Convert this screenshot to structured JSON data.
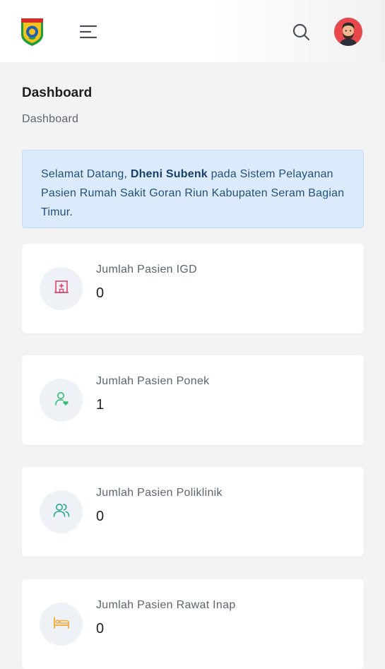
{
  "header": {
    "logo_icon": "regency-emblem-icon",
    "menu_icon": "hamburger-menu-icon",
    "search_icon": "search-icon",
    "avatar_icon": "user-avatar-icon"
  },
  "page": {
    "title": "Dashboard",
    "breadcrumb": "Dashboard"
  },
  "welcome": {
    "prefix": "Selamat Datang, ",
    "user_name": "Dheni Subenk",
    "suffix": " pada Sistem Pelayanan Pasien Rumah Sakit Goran Riun Kabupaten Seram Bagian Timur."
  },
  "stats": [
    {
      "label": "Jumlah Pasien IGD",
      "value": "0",
      "icon": "hospital-icon",
      "color": "#e0436a"
    },
    {
      "label": "Jumlah Pasien Ponek",
      "value": "1",
      "icon": "user-heart-icon",
      "color": "#2fbf71"
    },
    {
      "label": "Jumlah Pasien Poliklinik",
      "value": "0",
      "icon": "users-icon",
      "color": "#26a98a"
    },
    {
      "label": "Jumlah Pasien Rawat Inap",
      "value": "0",
      "icon": "bed-icon",
      "color": "#f2a93b"
    }
  ],
  "colors": {
    "alert_bg": "#dcebfb",
    "alert_text": "#23517c",
    "page_bg": "#f3f3f3"
  }
}
